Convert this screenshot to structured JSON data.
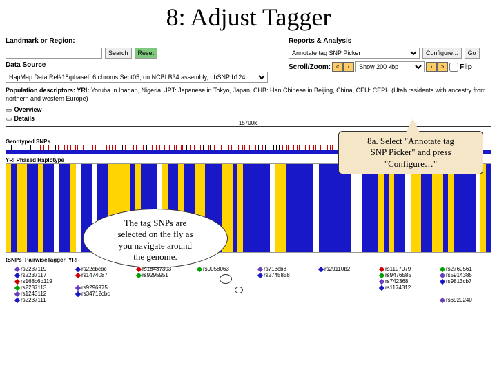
{
  "title": "8: Adjust Tagger",
  "form": {
    "landmark_label": "Landmark or Region:",
    "landmark_value": "",
    "search_label": "Search",
    "reset_label": "Reset",
    "datasource_label": "Data Source",
    "datasource_value": "HapMap Data Rel#18/phaseII 6 chroms Sept05, on NCBI B34 assembly, dbSNP b124",
    "reports_label": "Reports & Analysis",
    "reports_value": "Annotate tag SNP Picker",
    "configure_label": "Configure...",
    "go_label": "Go",
    "scrollzoom_label": "Scroll/Zoom:",
    "zoom_value": "Show 200 kbp",
    "flip_label": "Flip"
  },
  "pop": {
    "line1_prefix": "Population descriptors: YRI: ",
    "line1_rest": "Yoruba in Ibadan, Nigeria, JPT: Japanese in Tokyo, Japan, CHB: Han Chinese in Beijing, China, CEU: CEPH (Utah residents with ancestry from northern and western Europe)"
  },
  "toggles": {
    "overview": "Overview",
    "details": "Details"
  },
  "ruler_tick": "15700k",
  "track_genotyped": "Genotyped SNPs",
  "track_phased": "YRI Phased Haplotype",
  "track_tagger": "tSNPs_PairwiseTagger_YRI",
  "callout1": {
    "line1": "8a. Select \"Annotate tag",
    "line2": "SNP Picker\" and press",
    "line3": "\"Configure…\""
  },
  "thought": {
    "line1": "The tag SNPs are",
    "line2": "selected on the fly as",
    "line3": "you navigate around",
    "line4": "the genome."
  },
  "snps": [
    "rs2237119",
    "rs22cbcbc",
    "rs18437303",
    "rs0058063",
    "rs718cb8",
    "rs29110b2",
    "rs1107079",
    "rs2760561",
    "rs2237117",
    "rs1474087",
    "rs9295951",
    "",
    "rs2745858",
    "",
    "rs9476585",
    "rs5914385",
    "rs168c6b119",
    "",
    "",
    "",
    "",
    "",
    "rs742368",
    "rs9813cb7",
    "rs2237113",
    "rs9296975",
    "",
    "",
    "",
    "",
    "rs1174312",
    "",
    "rs1243112",
    "rs34712cbc",
    "",
    "",
    "",
    "",
    "",
    "",
    "rs2237111",
    "",
    "",
    "",
    "",
    "",
    "",
    "rs6920240"
  ],
  "snp_colors": [
    "#6a3fbf",
    "#1818c8",
    "#d00000",
    "#00a000"
  ]
}
